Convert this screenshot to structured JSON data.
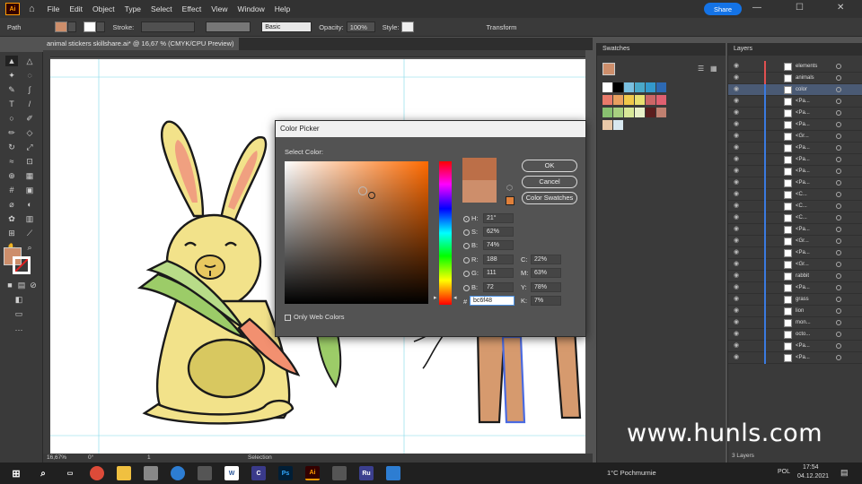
{
  "app": {
    "logo": "Ai",
    "menu": [
      "File",
      "Edit",
      "Object",
      "Type",
      "Select",
      "Effect",
      "View",
      "Window",
      "Help"
    ],
    "share_label": "Share"
  },
  "control": {
    "path_label": "Path",
    "stroke_label": "Stroke:",
    "basic_label": "Basic",
    "opacity_label": "Opacity:",
    "opacity_value": "100%",
    "style_label": "Style:",
    "transform_label": "Transform"
  },
  "document": {
    "tab_title": "animal stickers skillshare.ai* @ 16,67 % (CMYK/CPU Preview)",
    "close": "×"
  },
  "status": {
    "zoom": "16,67%",
    "rotation": "0°",
    "artboard": "1",
    "mode": "Selection"
  },
  "picker": {
    "title": "Color Picker",
    "select_color_label": "Select Color:",
    "ok": "OK",
    "cancel": "Cancel",
    "swatches": "Color Swatches",
    "only_web_colors": "Only Web Colors",
    "h_label": "H:",
    "h_value": "21°",
    "s_label": "S:",
    "s_value": "62%",
    "b_label": "B:",
    "b_value": "74%",
    "r_label": "R:",
    "r_value": "188",
    "g_label": "G:",
    "g_value": "111",
    "bl_label": "B:",
    "bl_value": "72",
    "c_label": "C:",
    "c_value": "22%",
    "m_label": "M:",
    "m_value": "63%",
    "y_label": "Y:",
    "y_value": "78%",
    "k_label": "K:",
    "k_value": "7%",
    "hex_label": "#",
    "hex_value": "bc6f48",
    "new_color": "#bc6f48",
    "current_color": "#cd8e6b"
  },
  "swatches_panel": {
    "title": "Swatches",
    "colors": [
      "#ffffff",
      "#000000",
      "#7ac0e0",
      "#4aa8c8",
      "#3399cc",
      "#2d69b3",
      "#e87a6a",
      "#e8a060",
      "#f0c84a",
      "#e8e070",
      "#cc6666",
      "#e06070",
      "#88c070",
      "#a8d080",
      "#d8e898",
      "#e8f0c8",
      "#5a1e1e",
      "#c08070",
      "#e8c8a8",
      "#d8e8f0"
    ]
  },
  "layers_panel": {
    "title": "Layers",
    "rows": [
      "elements",
      "animals",
      "color",
      "<Pa...",
      "<Pa...",
      "<Pa...",
      "<Gr...",
      "<Pa...",
      "<Pa...",
      "<Pa...",
      "<Pa...",
      "<C...",
      "<C...",
      "<C...",
      "<Pa...",
      "<Gr...",
      "<Pa...",
      "<Gr...",
      "rabbit",
      "<Pa...",
      "grass",
      "lion",
      "mon...",
      "octo...",
      "<Pa...",
      "<Pa..."
    ],
    "footer": "3 Layers"
  },
  "taskbar": {
    "weather": "1°C  Pochmurnie",
    "lang": "POL",
    "time": "17:54",
    "date": "04.12.2021"
  },
  "watermark": "www.hunls.com"
}
